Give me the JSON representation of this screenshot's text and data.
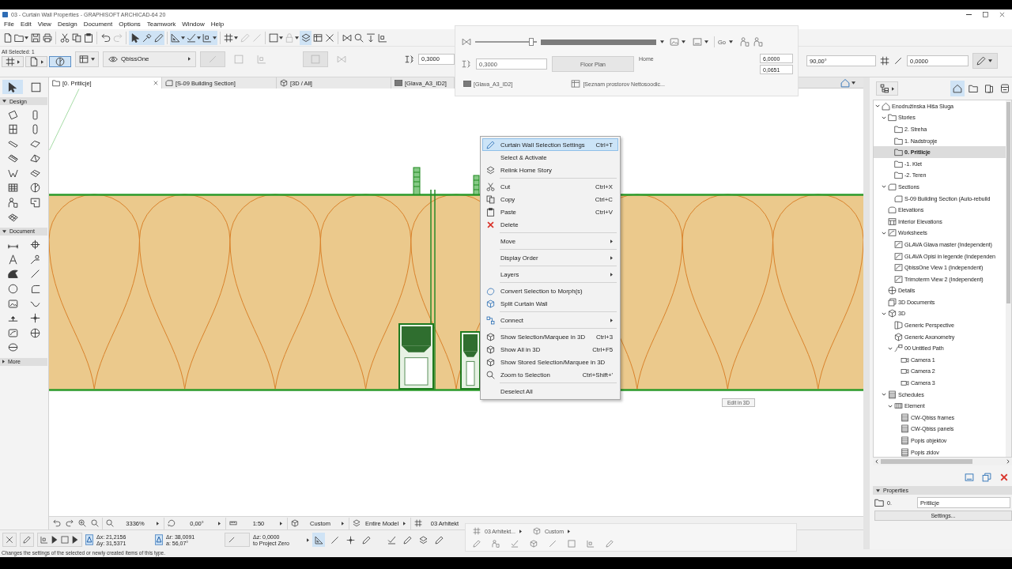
{
  "window": {
    "title": "03 - Curtain Wall Properties - GRAPHISOFT ARCHICAD-64 20"
  },
  "menu_bar": [
    "File",
    "Edit",
    "View",
    "Design",
    "Document",
    "Options",
    "Teamwork",
    "Window",
    "Help"
  ],
  "toolbar": [
    {
      "pressed": false,
      "disabled": false
    },
    {
      "pressed": false,
      "disabled": false
    },
    {
      "pressed": false,
      "disabled": false
    },
    {
      "pressed": false,
      "disabled": false
    },
    {
      "pressed": false,
      "disabled": false
    },
    {
      "pressed": false,
      "disabled": false
    },
    {
      "pressed": false,
      "disabled": false
    },
    {
      "pressed": false,
      "disabled": false
    },
    {
      "pressed": false,
      "disabled": true
    },
    {
      "pressed": true,
      "disabled": false
    },
    {
      "pressed": true,
      "disabled": false
    },
    {
      "pressed": true,
      "disabled": false
    },
    {
      "pressed": true,
      "disabled": false
    },
    {
      "pressed": true,
      "disabled": false
    },
    {
      "pressed": true,
      "disabled": false
    },
    {
      "pressed": false,
      "disabled": false
    },
    {
      "pressed": false,
      "disabled": true
    },
    {
      "pressed": false,
      "disabled": true
    },
    {
      "pressed": false,
      "disabled": false
    },
    {
      "pressed": false,
      "disabled": true
    },
    {
      "pressed": true,
      "disabled": false
    },
    {
      "pressed": false,
      "disabled": false
    },
    {
      "pressed": false,
      "disabled": false
    },
    {
      "pressed": false,
      "disabled": false
    },
    {
      "pressed": false,
      "disabled": false
    },
    {
      "pressed": false,
      "disabled": false
    },
    {
      "pressed": false,
      "disabled": false
    }
  ],
  "info_box": {
    "selection": "All Selected: 1",
    "mode_buttons": [
      {
        "pressed": false
      },
      {
        "pressed": false
      },
      {
        "pressed": true
      }
    ],
    "layer": "QbissOne",
    "controls": [
      {
        "disabled": true
      },
      {
        "disabled": true
      },
      {
        "disabled": true
      },
      {
        "disabled": true
      },
      {
        "disabled": true
      }
    ],
    "field": "0,3000",
    "right_fields": [
      "90,00°",
      "0,0000"
    ]
  },
  "view_tabs": [
    {
      "label": "[0. Pritlicje]",
      "kind": "plan",
      "selected": true,
      "closable": true
    },
    {
      "label": "[S-09 Building Section]",
      "kind": "section",
      "selected": false,
      "closable": false
    },
    {
      "label": "[3D / All]",
      "kind": "model",
      "selected": false,
      "closable": false
    },
    {
      "label": "[Glava_A3_ID2]",
      "kind": "layout",
      "selected": false,
      "closable": false
    }
  ],
  "toolbox": {
    "pointer_tools": [
      {
        "selected": true
      },
      {
        "selected": false
      }
    ],
    "sections": [
      {
        "label": "Design",
        "expanded": true
      },
      {
        "label": "Document",
        "expanded": true
      },
      {
        "label": "More",
        "expanded": false
      }
    ]
  },
  "canvas": {
    "tag": "Edit in 3D"
  },
  "context_menu": {
    "items": [
      {
        "kind": "item",
        "label": "Curtain Wall Selection Settings",
        "shortcut": "Ctrl+T",
        "submenu": false,
        "selected": true
      },
      {
        "kind": "item",
        "label": "Select & Activate",
        "submenu": false,
        "selected": false
      },
      {
        "kind": "item",
        "label": "Relink Home Story",
        "submenu": false,
        "selected": false
      },
      {
        "kind": "separator"
      },
      {
        "kind": "item",
        "label": "Cut",
        "shortcut": "Ctrl+X",
        "submenu": false,
        "selected": false
      },
      {
        "kind": "item",
        "label": "Copy",
        "shortcut": "Ctrl+C",
        "submenu": false,
        "selected": false
      },
      {
        "kind": "item",
        "label": "Paste",
        "shortcut": "Ctrl+V",
        "submenu": false,
        "selected": false
      },
      {
        "kind": "item",
        "label": "Delete",
        "submenu": false,
        "selected": false
      },
      {
        "kind": "separator"
      },
      {
        "kind": "item",
        "label": "Move",
        "submenu": true,
        "selected": false
      },
      {
        "kind": "separator"
      },
      {
        "kind": "item",
        "label": "Display Order",
        "submenu": true,
        "selected": false
      },
      {
        "kind": "separator"
      },
      {
        "kind": "item",
        "label": "Layers",
        "submenu": true,
        "selected": false
      },
      {
        "kind": "separator"
      },
      {
        "kind": "item",
        "label": "Convert Selection to Morph(s)",
        "submenu": false,
        "selected": false
      },
      {
        "kind": "item",
        "label": "Split Curtain Wall",
        "submenu": false,
        "selected": false
      },
      {
        "kind": "separator"
      },
      {
        "kind": "item",
        "label": "Connect",
        "submenu": true,
        "selected": false
      },
      {
        "kind": "separator"
      },
      {
        "kind": "item",
        "label": "Show Selection/Marquee in 3D",
        "shortcut": "Ctrl+3",
        "submenu": false,
        "selected": false
      },
      {
        "kind": "item",
        "label": "Show All in 3D",
        "shortcut": "Ctrl+F5",
        "submenu": false,
        "selected": false
      },
      {
        "kind": "item",
        "label": "Show Stored Selection/Marquee in 3D",
        "submenu": false,
        "selected": false
      },
      {
        "kind": "item",
        "label": "Zoom to Selection",
        "shortcut": "Ctrl+Shift+'",
        "submenu": false,
        "selected": false
      },
      {
        "kind": "separator"
      },
      {
        "kind": "item",
        "label": "Deselect All",
        "submenu": false,
        "selected": false
      }
    ]
  },
  "overlay_panel": {
    "slider": {
      "level": 0.95
    },
    "menu_button": "Go",
    "field": "0,3000",
    "view_button": "Floor Plan",
    "home_label": "Home",
    "values": [
      "6,0000",
      "0,0651"
    ],
    "tabs": [
      "[Glava_A3_ID2]",
      "[Seznam prostorov Nettosoodic..."
    ]
  },
  "overlay_bottom": {
    "layers": "03 Arhitekt...",
    "structure": "Custom"
  },
  "navigator": {
    "map_tabs": [
      {
        "selected": true
      },
      {
        "selected": false
      },
      {
        "selected": false
      },
      {
        "selected": false
      }
    ],
    "tree": [
      {
        "label": "Enodružinska Hiša Sluga",
        "kind": "project",
        "selected": false,
        "expanded": true,
        "children": [
          {
            "label": "Stories",
            "kind": "stories",
            "selected": false,
            "expanded": true,
            "children": [
              {
                "label": "2. Streha",
                "kind": "story",
                "selected": false
              },
              {
                "label": "1. Nadstropje",
                "kind": "story",
                "selected": false
              },
              {
                "label": "0. Pritlicje",
                "kind": "story",
                "selected": true
              },
              {
                "label": "-1. Klet",
                "kind": "story",
                "selected": false
              },
              {
                "label": "-2. Teren",
                "kind": "story",
                "selected": false
              }
            ]
          },
          {
            "label": "Sections",
            "kind": "section",
            "selected": false,
            "expanded": true,
            "children": [
              {
                "label": "S-09 Building Section (Auto-rebuild",
                "kind": "section",
                "selected": false
              }
            ]
          },
          {
            "label": "Elevations",
            "kind": "elevation",
            "selected": false
          },
          {
            "label": "Interior Elevations",
            "kind": "interior",
            "selected": false
          },
          {
            "label": "Worksheets",
            "kind": "worksheet",
            "selected": false,
            "expanded": true,
            "children": [
              {
                "label": "GLAVA Glava master (Independent)",
                "kind": "worksheet",
                "selected": false
              },
              {
                "label": "GLAVA Opisi in legende (Independen",
                "kind": "worksheet",
                "selected": false
              },
              {
                "label": "QbissOne View 1 (Independent)",
                "kind": "worksheet",
                "selected": false
              },
              {
                "label": "Trimoterm View 2 (Independent)",
                "kind": "worksheet",
                "selected": false
              }
            ]
          },
          {
            "label": "Details",
            "kind": "detail",
            "selected": false
          },
          {
            "label": "3D Documents",
            "kind": "documents",
            "selected": false
          },
          {
            "label": "3D",
            "kind": "model",
            "selected": false,
            "expanded": true,
            "children": [
              {
                "label": "Generic Perspective",
                "kind": "perspective",
                "selected": false
              },
              {
                "label": "Generic Axonometry",
                "kind": "axonometry",
                "selected": false
              },
              {
                "label": "00 Untitled Path",
                "kind": "path",
                "selected": false,
                "expanded": true,
                "children": [
                  {
                    "label": "Camera 1",
                    "kind": "camera",
                    "selected": false
                  },
                  {
                    "label": "Camera 2",
                    "kind": "camera",
                    "selected": false
                  },
                  {
                    "label": "Camera 3",
                    "kind": "camera",
                    "selected": false
                  }
                ]
              }
            ]
          },
          {
            "label": "Schedules",
            "kind": "schedules",
            "selected": false,
            "expanded": true,
            "children": [
              {
                "label": "Element",
                "kind": "list",
                "selected": false,
                "expanded": true,
                "children": [
                  {
                    "label": "CW-Qbiss frames",
                    "kind": "schedule",
                    "selected": false
                  },
                  {
                    "label": "CW-Qbiss panels",
                    "kind": "schedule",
                    "selected": false
                  },
                  {
                    "label": "Popis objektov",
                    "kind": "schedule",
                    "selected": false
                  },
                  {
                    "label": "Popis zidov",
                    "kind": "schedule",
                    "selected": false
                  }
                ]
              }
            ]
          }
        ]
      }
    ],
    "properties": {
      "title": "Properties",
      "expanded": true,
      "number": "0.",
      "name": "Pritlicje",
      "button": "Settings..."
    }
  },
  "view_bar": {
    "zoom": "3336%",
    "rotation": "0,00°",
    "scale": "1:50",
    "structure": "Custom",
    "model": "Entire Model",
    "layers": "03 Arhitekt"
  },
  "coordinates": {
    "x": "Δx: 21,2156",
    "y": "Δy: 31,5371",
    "r": "Δr: 38,0091",
    "angle": "a: 56,07°",
    "z": "Δz: 0,0000",
    "reference": "to Project Zero",
    "tools": [
      {
        "pressed": true
      },
      {
        "pressed": false
      },
      {
        "pressed": false
      },
      {
        "pressed": false
      },
      {
        "pressed": false
      },
      {
        "pressed": false
      },
      {
        "pressed": false
      },
      {
        "pressed": false
      }
    ]
  },
  "status_bar": "Changes the settings of the selected or newly created items of this type."
}
